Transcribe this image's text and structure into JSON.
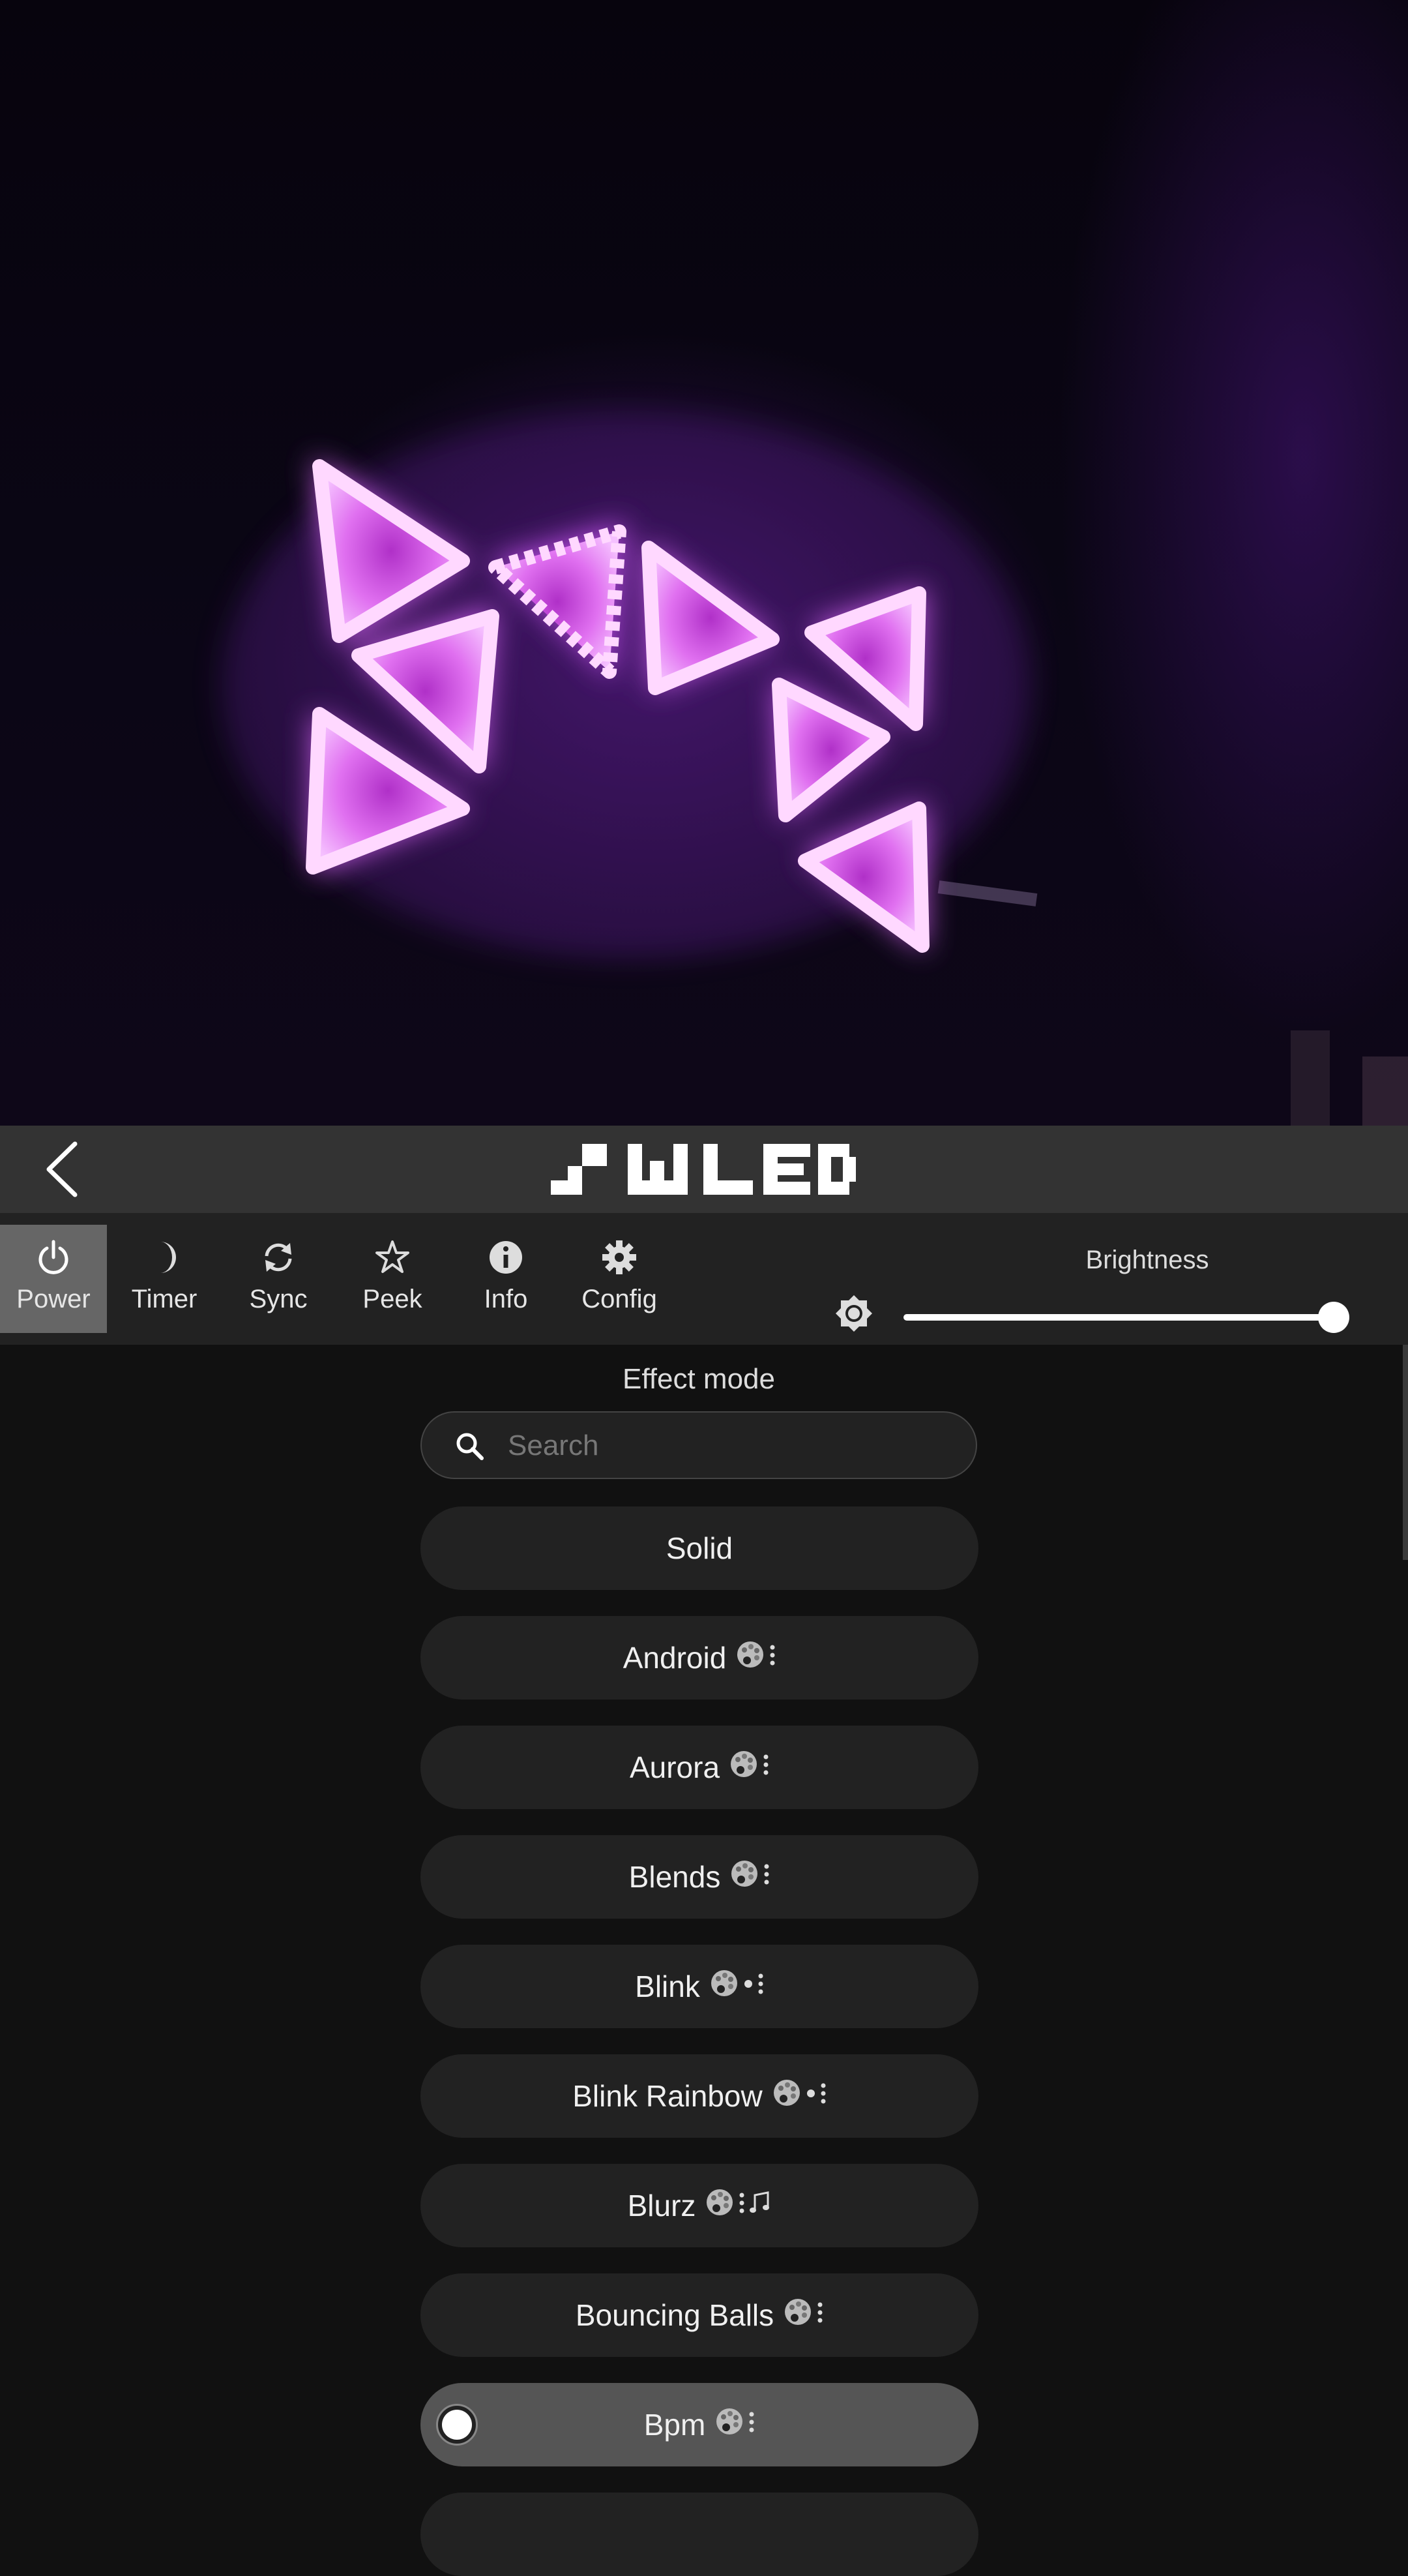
{
  "header": {
    "logo_text": "WLED"
  },
  "toolbar": {
    "buttons": [
      {
        "label": "Power",
        "icon": "power-icon"
      },
      {
        "label": "Timer",
        "icon": "moon-icon"
      },
      {
        "label": "Sync",
        "icon": "sync-icon"
      },
      {
        "label": "Peek",
        "icon": "star-icon"
      },
      {
        "label": "Info",
        "icon": "info-icon"
      },
      {
        "label": "Config",
        "icon": "gear-icon"
      }
    ],
    "active": "Power",
    "brightness": {
      "label": "Brightness",
      "value_percent": 100
    }
  },
  "effects": {
    "title": "Effect mode",
    "search_placeholder": "Search",
    "selected": "Bpm",
    "items": [
      {
        "name": "Solid",
        "flags": []
      },
      {
        "name": "Android",
        "flags": [
          "palette-icon",
          "dots-icon"
        ]
      },
      {
        "name": "Aurora",
        "flags": [
          "palette-icon",
          "dots-icon"
        ]
      },
      {
        "name": "Blends",
        "flags": [
          "palette-icon",
          "dots-icon"
        ]
      },
      {
        "name": "Blink",
        "flags": [
          "palette-icon",
          "bullet-icon",
          "dots-icon"
        ]
      },
      {
        "name": "Blink Rainbow",
        "flags": [
          "palette-icon",
          "bullet-icon",
          "dots-icon"
        ]
      },
      {
        "name": "Blurz",
        "flags": [
          "palette-icon",
          "dots-icon",
          "music-icon"
        ]
      },
      {
        "name": "Bouncing Balls",
        "flags": [
          "palette-icon",
          "dots-icon"
        ]
      },
      {
        "name": "Bpm",
        "flags": [
          "palette-icon",
          "dots-icon"
        ]
      }
    ]
  },
  "colors": {
    "header_bg": "#333333",
    "toolbar_bg": "#222222",
    "active_tab": "#666666",
    "pill_bg": "#222222",
    "pill_selected": "#555555",
    "led_magenta": "#e070f0"
  }
}
